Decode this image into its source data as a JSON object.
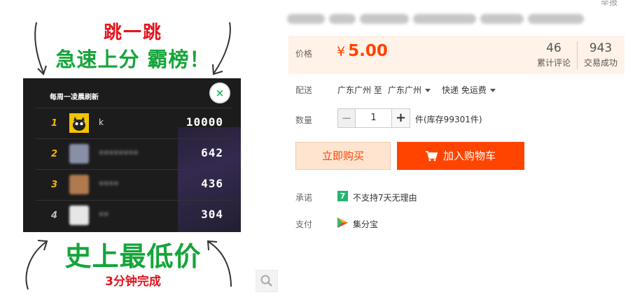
{
  "promo": {
    "headline_top": "跳一跳",
    "headline_sub": "急速上分 霸榜！",
    "headline_bottom": "史上最低价",
    "headline_note": "3分钟完成",
    "board_title": "每周一凌晨刷新",
    "close_glyph": "×",
    "ranks": [
      {
        "num": "1",
        "name": "k",
        "score": "10000",
        "num_color": "#f5b400",
        "avatar_color": "#f2c400"
      },
      {
        "num": "2",
        "name": "••••••••",
        "score": "642",
        "num_color": "#f5b400",
        "avatar_color": "#8a8fa8"
      },
      {
        "num": "3",
        "name": "••••",
        "score": "436",
        "num_color": "#f5b400",
        "avatar_color": "#b07a4e"
      },
      {
        "num": "4",
        "name": "••",
        "score": "304",
        "num_color": "#bbbbbb",
        "avatar_color": "#d9d9d9"
      }
    ]
  },
  "product": {
    "report_label": "举报",
    "price": {
      "label": "价格",
      "currency": "¥",
      "value": "5.00"
    },
    "stats": [
      {
        "value": "46",
        "label": "累计评论"
      },
      {
        "value": "943",
        "label": "交易成功"
      }
    ],
    "shipping": {
      "label": "配送",
      "from": "广东广州 至",
      "to": "广东广州",
      "method": "快递 免运费"
    },
    "quantity": {
      "label": "数量",
      "minus": "−",
      "value": "1",
      "plus": "+",
      "stock": "件(库存99301件)"
    },
    "buttons": {
      "buy_now": "立即购买",
      "add_cart": "加入购物车"
    },
    "promise": {
      "label": "承诺",
      "badge": "7",
      "text": "不支持7天无理由"
    },
    "payment": {
      "label": "支付",
      "text": "集分宝"
    }
  },
  "colors": {
    "accent": "#ff4400",
    "price_bg": "#fff2e8",
    "promo_red": "#e0161e",
    "promo_green": "#15a53a"
  },
  "icons": [
    "close-icon",
    "zoom-icon",
    "cart-icon",
    "seven-day-icon",
    "jifenbao-icon",
    "caret-down-icon"
  ]
}
